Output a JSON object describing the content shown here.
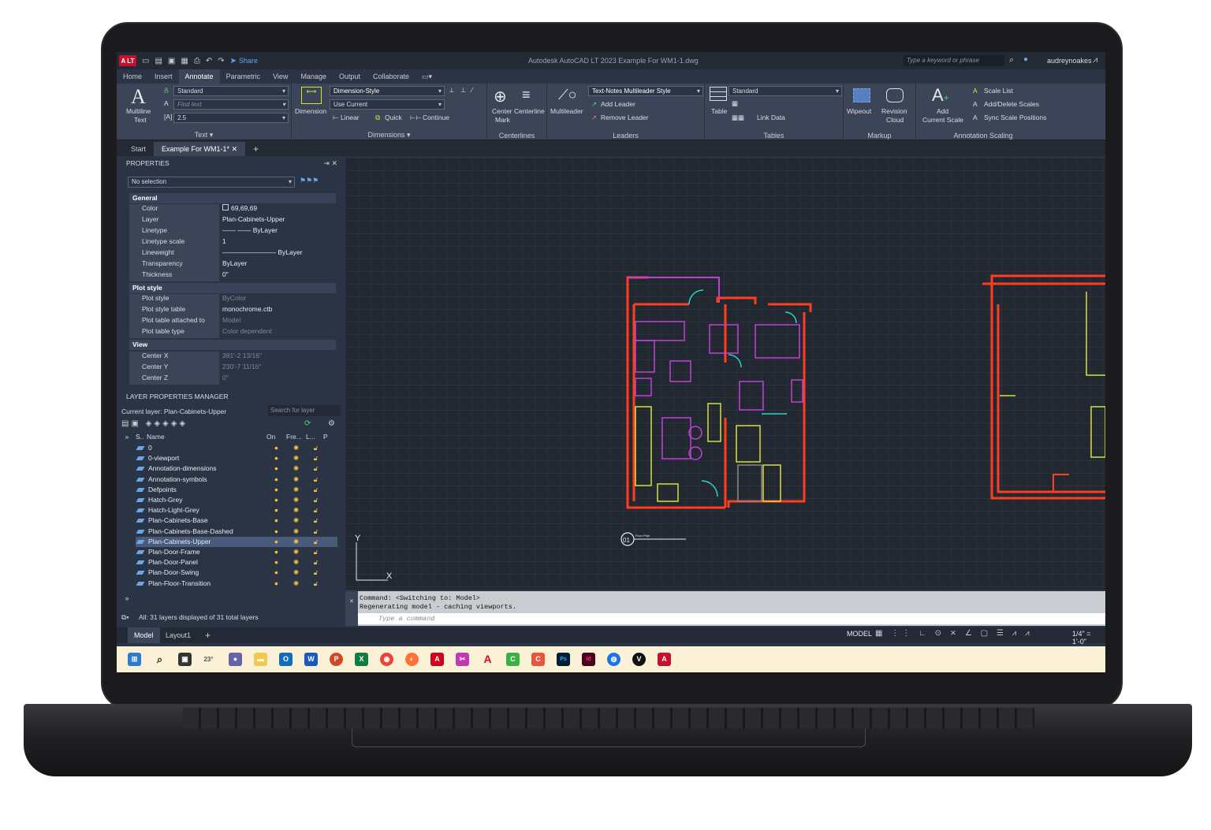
{
  "app": {
    "logo": "A LT",
    "share_label": "Share",
    "title": "Autodesk AutoCAD LT 2023   Example For WM1-1.dwg",
    "search_placeholder": "Type a keyword or phrase",
    "user": "audreynoakes"
  },
  "ribbon_tabs": [
    "Home",
    "Insert",
    "Annotate",
    "Parametric",
    "View",
    "Manage",
    "Output",
    "Collaborate"
  ],
  "ribbon": {
    "text_panel": {
      "multiline_text": "Multiline",
      "multiline_text2": "Text",
      "style": "Standard",
      "find_placeholder": "Find text",
      "height": "2.5",
      "title": "Text ▾"
    },
    "dimensions_panel": {
      "dimension_label": "Dimension",
      "dim_style": "Dimension-Style",
      "layer": "Use Current",
      "linear": "Linear",
      "quick": "Quick",
      "continue": "Continue",
      "title": "Dimensions ▾"
    },
    "centerlines_panel": {
      "center_mark": "Center",
      "center_mark2": "Mark",
      "centerline": "Centerline",
      "title": "Centerlines"
    },
    "leaders_panel": {
      "multileader": "Multileader",
      "style": "Text-Notes Multileader Style",
      "add_leader": "Add Leader",
      "remove_leader": "Remove Leader",
      "title": "Leaders"
    },
    "tables_panel": {
      "table": "Table",
      "style": "Standard",
      "link_data": "Link Data",
      "title": "Tables"
    },
    "markup_panel": {
      "wipeout": "Wipeout",
      "revision": "Revision",
      "revision2": "Cloud",
      "title": "Markup"
    },
    "scaling_panel": {
      "add_scale": "Add",
      "add_scale2": "Current Scale",
      "scale_list": "Scale List",
      "add_delete": "Add/Delete Scales",
      "sync": "Sync Scale Positions",
      "title": "Annotation Scaling"
    }
  },
  "doc_tabs": [
    "Start",
    "Example For WM1-1*"
  ],
  "properties": {
    "title": "PROPERTIES",
    "selection": "No selection",
    "general_title": "General",
    "general": [
      {
        "k": "Color",
        "v": "69,69,69"
      },
      {
        "k": "Layer",
        "v": "Plan-Cabinets-Upper"
      },
      {
        "k": "Linetype",
        "v": "ByLayer"
      },
      {
        "k": "Linetype scale",
        "v": "1"
      },
      {
        "k": "Lineweight",
        "v": "ByLayer"
      },
      {
        "k": "Transparency",
        "v": "ByLayer"
      },
      {
        "k": "Thickness",
        "v": "0\""
      }
    ],
    "plot_title": "Plot style",
    "plot": [
      {
        "k": "Plot style",
        "v": "ByColor"
      },
      {
        "k": "Plot style table",
        "v": "monochrome.ctb"
      },
      {
        "k": "Plot table attached to",
        "v": "Model"
      },
      {
        "k": "Plot table type",
        "v": "Color dependent"
      }
    ],
    "view_title": "View",
    "view": [
      {
        "k": "Center X",
        "v": "381'-2 13/16\""
      },
      {
        "k": "Center Y",
        "v": "230'-7 11/16\""
      },
      {
        "k": "Center Z",
        "v": "0\""
      }
    ]
  },
  "layers": {
    "title": "LAYER PROPERTIES MANAGER",
    "current": "Current layer: Plan-Cabinets-Upper",
    "search_placeholder": "Search for layer",
    "columns": [
      "S..",
      "Name",
      "On",
      "Fre...",
      "L...",
      "P"
    ],
    "items": [
      "0",
      "0-viewport",
      "Annotation-dimensions",
      "Annotation-symbols",
      "Defpoints",
      "Hatch-Grey",
      "Hatch-Light-Grey",
      "Plan-Cabinets-Base",
      "Plan-Cabinets-Base-Dashed",
      "Plan-Cabinets-Upper",
      "Plan-Door-Frame",
      "Plan-Door-Panel",
      "Plan-Door-Swing",
      "Plan-Floor-Transition"
    ],
    "footer": "All: 31 layers displayed of 31 total layers"
  },
  "drawing": {
    "label_number": "01",
    "label_text": "Floor Plan",
    "ucs_x": "X",
    "ucs_y": "Y"
  },
  "command": {
    "line1": "Command:   <Switching to: Model>",
    "line2": "Regenerating model - caching viewports.",
    "placeholder": "Type a command"
  },
  "status": {
    "tab_model": "Model",
    "tab_layout": "Layout1",
    "mode": "MODEL",
    "scale": "1/4\" = 1'-0\""
  },
  "taskbar": {
    "weather": "23°"
  },
  "colors": {
    "wall": "#ff3d1f",
    "cabinet": "#c23fd6",
    "fixture": "#d8e03a",
    "door": "#2fd1d1"
  }
}
